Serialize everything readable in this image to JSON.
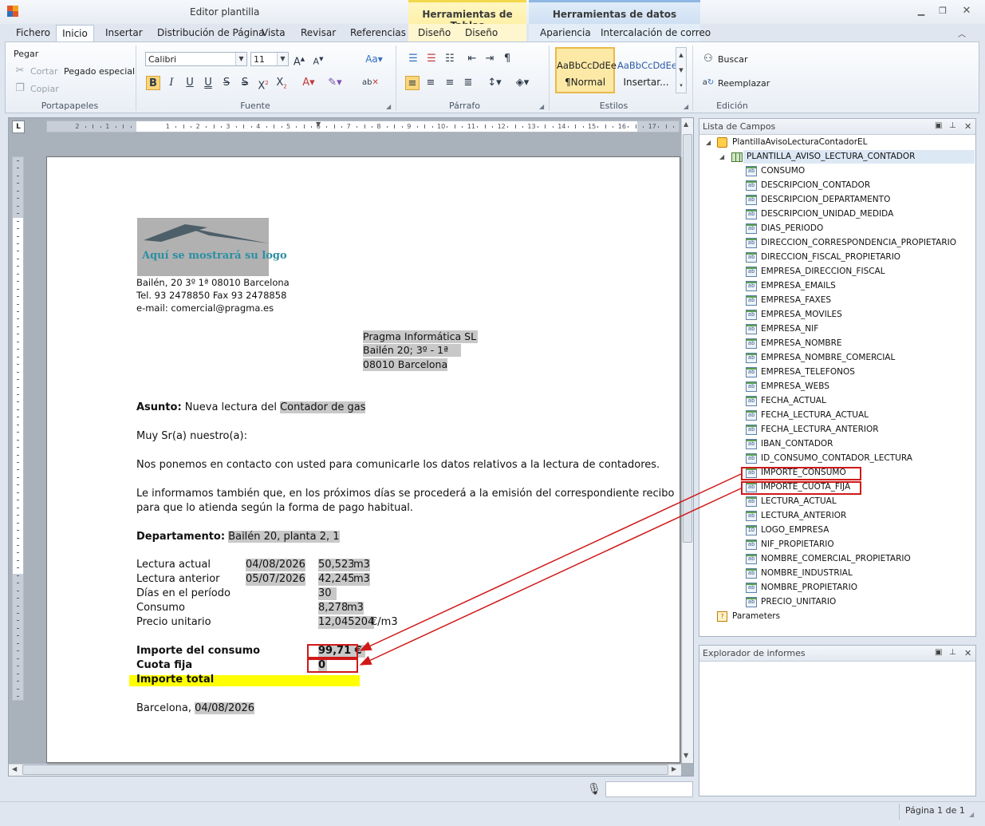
{
  "window": {
    "title": "Editor plantilla",
    "context_tabs": {
      "tables": "Herramientas de Tablas",
      "data": "Herramientas de datos"
    }
  },
  "tabs": [
    "Fichero",
    "Inicio",
    "Insertar",
    "Distribución de Página",
    "Vista",
    "Revisar",
    "Referencias",
    "Diseño",
    "Diseño",
    "Apariencia",
    "Intercalación de correo"
  ],
  "ribbon": {
    "clipboard": {
      "label": "Portapapeles",
      "paste": "Pegar",
      "cut": "Cortar",
      "copy": "Copiar",
      "paste_special": "Pegado especial"
    },
    "font": {
      "label": "Fuente",
      "family": "Calibri",
      "size": "11"
    },
    "paragraph": {
      "label": "Párrafo"
    },
    "styles": {
      "label": "Estilos",
      "normal_preview": "AaBbCcDdEe",
      "normal_name": "¶Normal",
      "insert_preview": "AaBbCcDdEe",
      "insert_name": "Insertar..."
    },
    "editing": {
      "label": "Edición",
      "find": "Buscar",
      "replace": "Reemplazar"
    }
  },
  "ruler": {
    "h_numbers": [
      "2",
      "1",
      "1",
      "2",
      "3",
      "4",
      "5",
      "6",
      "7",
      "8",
      "9",
      "10",
      "11",
      "12",
      "13",
      "14",
      "15",
      "16",
      "17"
    ]
  },
  "document": {
    "logo_text": "Aquí se mostrará su logo",
    "sender": [
      "Bailén, 20 3º 1ª 08010 Barcelona",
      "Tel. 93 2478850 Fax 93 2478858",
      "e-mail: comercial@pragma.es"
    ],
    "recipient": [
      "Pragma Informática SL",
      "Bailén 20; 3º - 1ª",
      "08010 Barcelona"
    ],
    "subject_label": "Asunto:",
    "subject_text": "Nueva lectura del",
    "subject_field": "Contador de gas",
    "greeting": "Muy Sr(a) nuestro(a):",
    "para1": "Nos ponemos en contacto con usted para comunicarle los datos relativos a la lectura de contadores.",
    "para2_line1": "Le informamos también que, en los próximos días se procederá a la emisión del correspondiente recibo",
    "para2_line2": "para que lo atienda según la forma de pago habitual.",
    "department_label": "Departamento:",
    "department_value": "Bailén 20, planta 2, 1",
    "rows": [
      {
        "label": "Lectura actual",
        "date": "04/08/2026",
        "value": "50,523",
        "unit": "m3"
      },
      {
        "label": "Lectura anterior",
        "date": "05/07/2026",
        "value": "42,245",
        "unit": "m3"
      },
      {
        "label": "Días en el período",
        "date": "",
        "value": "30",
        "unit": ""
      },
      {
        "label": "Consumo",
        "date": "",
        "value": "8,278",
        "unit": "m3"
      },
      {
        "label": "Precio unitario",
        "date": "",
        "value": "12,045204",
        "unit": "€/m3"
      }
    ],
    "amount_label": "Importe del consumo",
    "amount_value": "99,71 €",
    "fixed_label": "Cuota fija",
    "fixed_value": "0",
    "total_label": "Importe total",
    "place": "Barcelona,",
    "place_date": "04/08/2026"
  },
  "field_list": {
    "title": "Lista de Campos",
    "root": "PlantillaAvisoLecturaContadorEL",
    "table": "PLANTILLA_AVISO_LECTURA_CONTADOR",
    "fields": [
      "CONSUMO",
      "DESCRIPCION_CONTADOR",
      "DESCRIPCION_DEPARTAMENTO",
      "DESCRIPCION_UNIDAD_MEDIDA",
      "DIAS_PERIODO",
      "DIRECCION_CORRESPONDENCIA_PROPIETARIO",
      "DIRECCION_FISCAL_PROPIETARIO",
      "EMPRESA_DIRECCION_FISCAL",
      "EMPRESA_EMAILS",
      "EMPRESA_FAXES",
      "EMPRESA_MOVILES",
      "EMPRESA_NIF",
      "EMPRESA_NOMBRE",
      "EMPRESA_NOMBRE_COMERCIAL",
      "EMPRESA_TELEFONOS",
      "EMPRESA_WEBS",
      "FECHA_ACTUAL",
      "FECHA_LECTURA_ACTUAL",
      "FECHA_LECTURA_ANTERIOR",
      "IBAN_CONTADOR",
      "ID_CONSUMO_CONTADOR_LECTURA",
      "IMPORTE_CONSUMO",
      "IMPORTE_CUOTA_FIJA",
      "LECTURA_ACTUAL",
      "LECTURA_ANTERIOR",
      "LOGO_EMPRESA",
      "NIF_PROPIETARIO",
      "NOMBRE_COMERCIAL_PROPIETARIO",
      "NOMBRE_INDUSTRIAL",
      "NOMBRE_PROPIETARIO",
      "PRECIO_UNITARIO"
    ],
    "parameters": "Parameters"
  },
  "report_explorer": {
    "title": "Explorador de informes"
  },
  "status": {
    "page": "Página 1 de 1"
  },
  "colors": {
    "highlight_red": "#d01919",
    "field_gray": "#c8c8c8",
    "total_yellow": "#ffff00"
  }
}
